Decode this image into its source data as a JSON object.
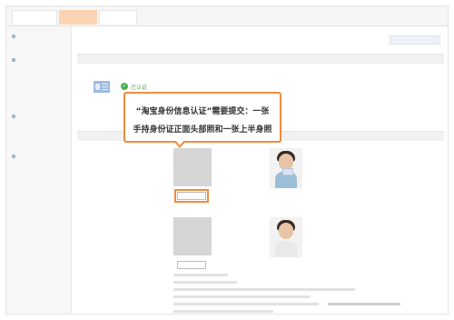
{
  "callout": {
    "line1": "“淘宝身份信息认证”需要提交：一张",
    "line2": "手持身份证正面头部照和一张上半身照"
  },
  "status": {
    "verified_label": "已认证"
  },
  "colors": {
    "callout_border": "#f08c3c",
    "verified_green": "#4caf50",
    "active_tab": "#fbd3b2"
  }
}
